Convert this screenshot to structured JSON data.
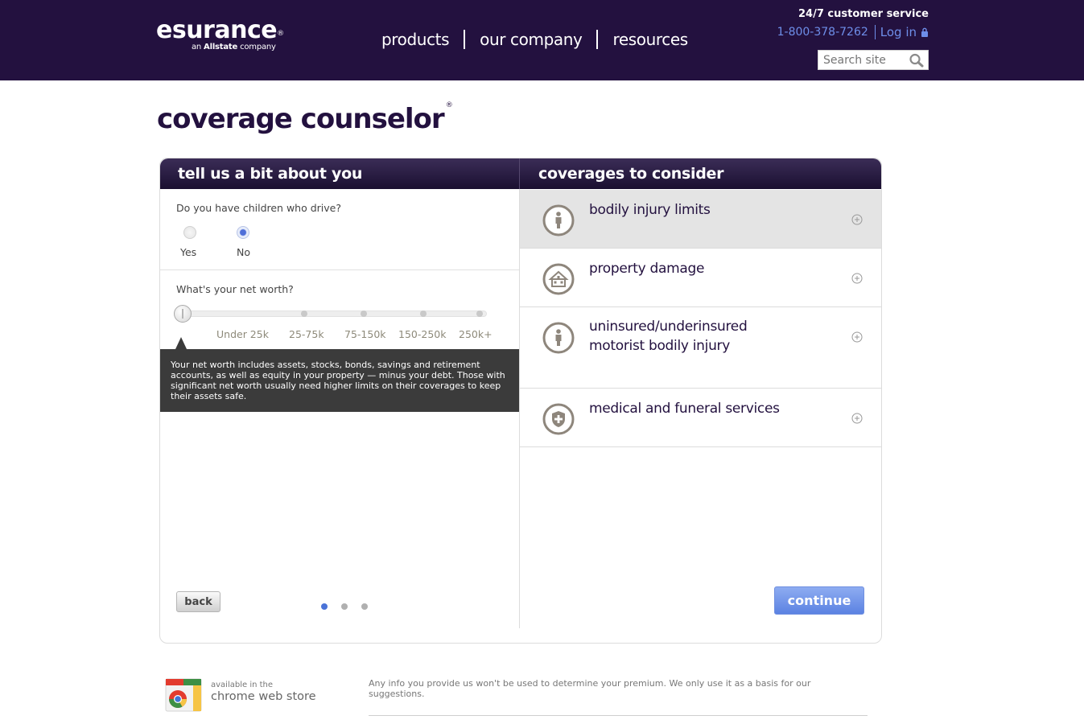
{
  "header": {
    "logo_text": "esurance",
    "logo_reg": "®",
    "logo_sub_prefix": "an ",
    "logo_sub_brand": "Allstate",
    "logo_sub_suffix": " company",
    "nav": [
      "products",
      "our company",
      "resources"
    ],
    "customer_service": "24/7 customer service",
    "phone": "1-800-378-7262",
    "login": "Log in",
    "search_placeholder": "Search site"
  },
  "page": {
    "title": "coverage counselor",
    "title_reg": "®"
  },
  "left_panel": {
    "heading": "tell us a bit about you",
    "question1": "Do you have children who drive?",
    "options": [
      {
        "label": "Yes",
        "checked": false
      },
      {
        "label": "No",
        "checked": true
      }
    ],
    "question2": "What's your net worth?",
    "slider_labels": [
      "Under 25k",
      "25-75k",
      "75-150k",
      "150-250k",
      "250k+"
    ],
    "tooltip": "Your net worth includes assets, stocks, bonds, savings and retirement accounts, as well as equity in your property — minus your debt. Those with significant net worth usually need higher limits on their coverages to keep their assets safe.",
    "back": "back",
    "step_current": 1,
    "step_total": 3
  },
  "right_panel": {
    "heading": "coverages to consider",
    "items": [
      {
        "line1": "bodily injury limits",
        "line2": "",
        "icon": "person-icon"
      },
      {
        "line1": "property damage",
        "line2": "",
        "icon": "house-icon"
      },
      {
        "line1": "uninsured/underinsured",
        "line2": "motorist bodily injury",
        "icon": "person-icon"
      },
      {
        "line1": "medical and funeral services",
        "line2": "",
        "icon": "shield-cross-icon"
      }
    ],
    "continue": "continue"
  },
  "footer": {
    "store_small": "available in the",
    "store_big": "chrome web store",
    "disclaimer": "Any info you provide us won't be used to determine your premium. We only use it as a basis for our suggestions."
  },
  "colors": {
    "header_bg": "#23113f",
    "link_blue": "#6e8ee9",
    "continue_blue": "#5b82e2",
    "selected_row": "#e4e4e4"
  }
}
